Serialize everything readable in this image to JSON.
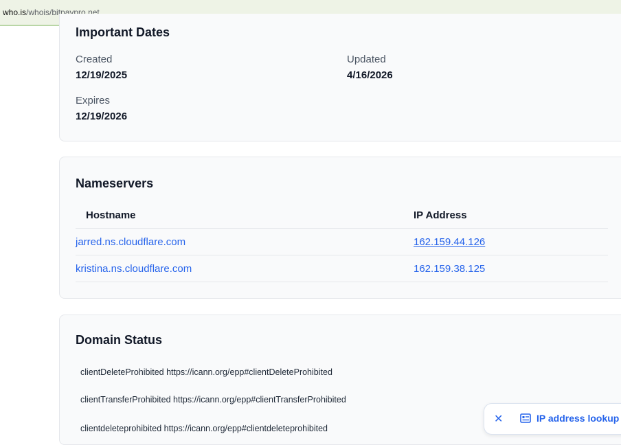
{
  "url": {
    "host": "who.is",
    "path": "/whois/bitpaypro.net"
  },
  "important_dates": {
    "title": "Important Dates",
    "created_label": "Created",
    "created": "12/19/2025",
    "updated_label": "Updated",
    "updated": "4/16/2026",
    "expires_label": "Expires",
    "expires": "12/19/2026"
  },
  "nameservers": {
    "title": "Nameservers",
    "col_host": "Hostname",
    "col_ip": "IP Address",
    "rows": [
      {
        "host": "jarred.ns.cloudflare.com",
        "ip": "162.159.44.126"
      },
      {
        "host": "kristina.ns.cloudflare.com",
        "ip": "162.159.38.125"
      }
    ]
  },
  "domain_status": {
    "title": "Domain Status",
    "items": [
      "clientDeleteProhibited https://icann.org/epp#clientDeleteProhibited",
      "clientTransferProhibited https://icann.org/epp#clientTransferProhibited",
      "clientdeleteprohibited https://icann.org/epp#clientdeleteprohibited"
    ]
  },
  "toast": {
    "label": "IP address lookup",
    "close_icon": "close-icon",
    "icon": "id-card-icon"
  },
  "colors": {
    "link": "#2563eb",
    "card_bg": "#f9fafb",
    "urlbar_bg": "#eef3e6"
  }
}
